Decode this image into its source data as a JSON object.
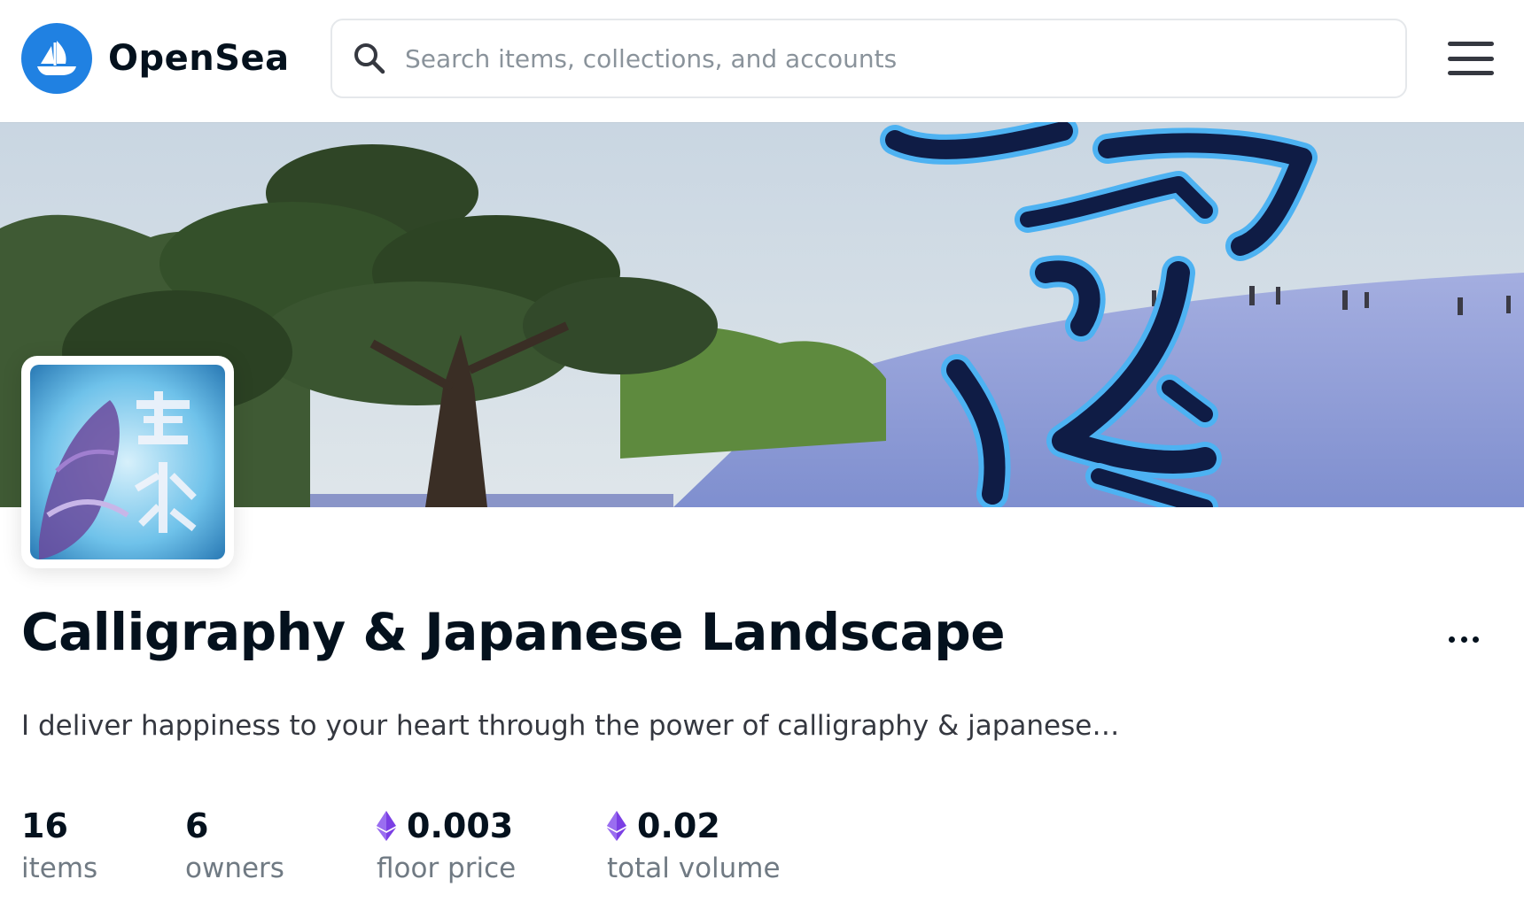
{
  "header": {
    "logo_text": "OpenSea",
    "search_placeholder": "Search items, collections, and accounts"
  },
  "collection": {
    "title": "Calligraphy & Japanese Landscape",
    "description": "I deliver happiness to your heart through the power of calligraphy & japanese…"
  },
  "stats": [
    {
      "value": "16",
      "label": "items",
      "currency": ""
    },
    {
      "value": "6",
      "label": "owners",
      "currency": ""
    },
    {
      "value": "0.003",
      "label": "floor price",
      "currency": "eth-icon"
    },
    {
      "value": "0.02",
      "label": "total volume",
      "currency": "eth-icon"
    }
  ],
  "colors": {
    "brand_blue": "#2081e2",
    "text_dark": "#04111d",
    "text_muted": "#707a83",
    "eth_purple": "#7b3fe4"
  }
}
